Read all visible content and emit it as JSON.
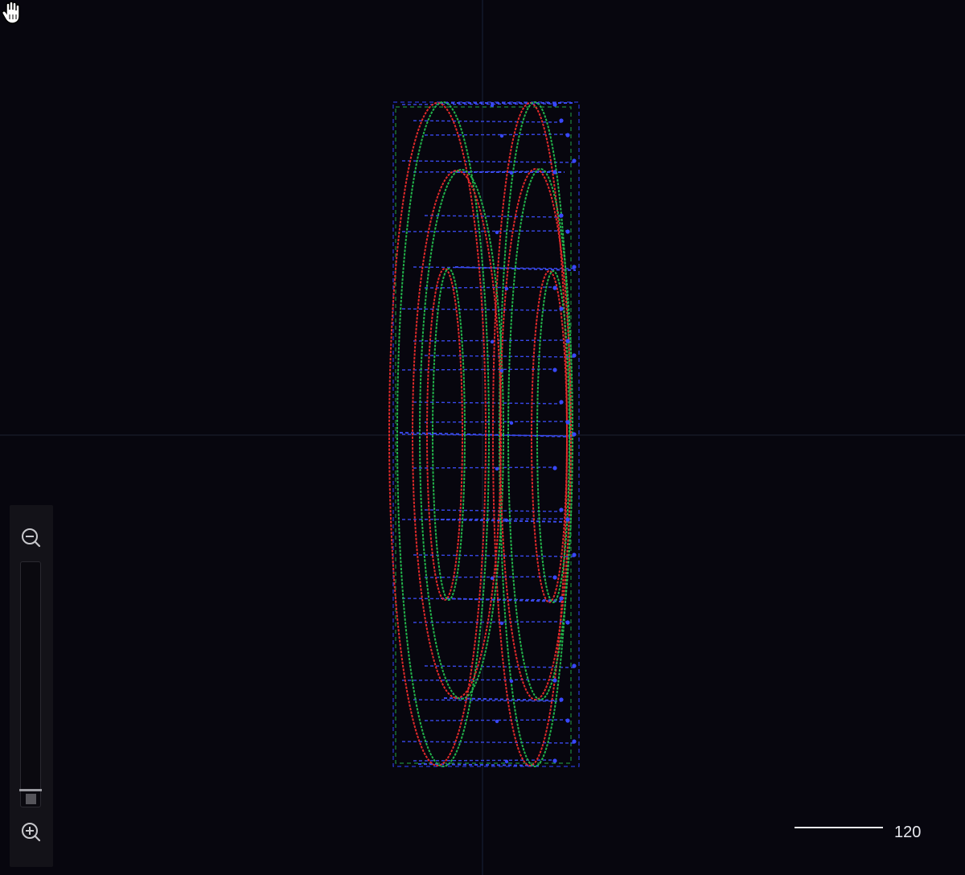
{
  "viewport": {
    "background": "#07060e",
    "axis_color": "#1a2436",
    "colors": {
      "red": "#e02a2a",
      "green": "#22b34a",
      "blue": "#2a3ad8"
    }
  },
  "zoom": {
    "level": 0.0,
    "zoom_out_icon": "zoom-out-icon",
    "zoom_in_icon": "zoom-in-icon"
  },
  "scale": {
    "label": "120"
  },
  "cursor": {
    "icon": "hand-grab-icon"
  }
}
